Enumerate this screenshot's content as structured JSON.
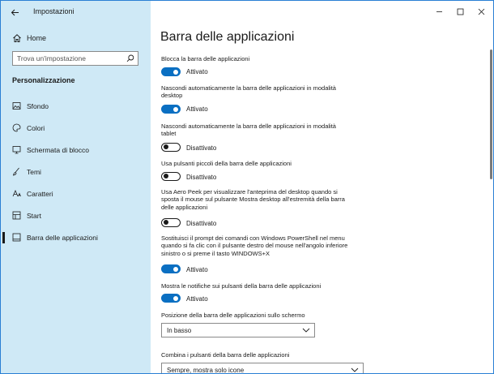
{
  "window": {
    "title": "Impostazioni"
  },
  "sidebar": {
    "home_label": "Home",
    "search_placeholder": "Trova un'impostazione",
    "section_title": "Personalizzazione",
    "items": [
      {
        "label": "Sfondo",
        "icon": "picture-icon"
      },
      {
        "label": "Colori",
        "icon": "palette-icon"
      },
      {
        "label": "Schermata di blocco",
        "icon": "monitor-icon"
      },
      {
        "label": "Temi",
        "icon": "brush-icon"
      },
      {
        "label": "Caratteri",
        "icon": "font-icon"
      },
      {
        "label": "Start",
        "icon": "start-icon"
      },
      {
        "label": "Barra delle applicazioni",
        "icon": "taskbar-icon",
        "active": true
      }
    ]
  },
  "main": {
    "title": "Barra delle applicazioni",
    "settings": [
      {
        "label": "Blocca la barra delle applicazioni",
        "on": true,
        "status": "Attivato"
      },
      {
        "label_lines": [
          "Nascondi automaticamente la barra delle applicazioni in modalità",
          "desktop"
        ],
        "on": true,
        "status": "Attivato"
      },
      {
        "label_lines": [
          "Nascondi automaticamente la barra delle applicazioni in modalità",
          "tablet"
        ],
        "on": false,
        "status": "Disattivato"
      },
      {
        "label": "Usa pulsanti piccoli della barra delle applicazioni",
        "on": false,
        "status": "Disattivato"
      },
      {
        "label_lines": [
          "Usa Aero Peek per visualizzare l'anteprima del desktop quando si",
          "sposta il mouse sul pulsante Mostra desktop all'estremità della barra",
          "delle applicazioni"
        ],
        "on": false,
        "status": "Disattivato"
      },
      {
        "label_lines": [
          "Sostituisci il prompt dei comandi con Windows PowerShell nel menu",
          "quando si fa clic con il pulsante destro del mouse nell'angolo inferiore",
          "sinistro o si preme il tasto WINDOWS+X"
        ],
        "on": true,
        "status": "Attivato"
      },
      {
        "label": "Mostra le notifiche sui pulsanti della barra delle applicazioni",
        "on": true,
        "status": "Attivato"
      }
    ],
    "position": {
      "label": "Posizione della barra delle applicazioni sullo schermo",
      "value": "In basso"
    },
    "combine": {
      "label": "Combina i pulsanti della barra delle applicazioni",
      "value": "Sempre, mostra solo icone"
    }
  },
  "colors": {
    "accent": "#0a6fc2",
    "sidebar_bg": "#cfe9f6"
  }
}
